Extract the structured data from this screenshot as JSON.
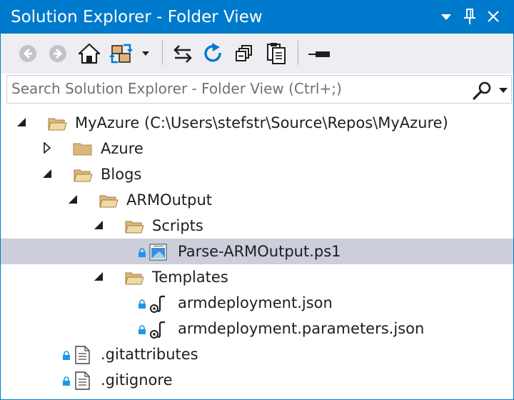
{
  "window": {
    "title": "Solution Explorer - Folder View",
    "accent_color": "#007acc",
    "title_text_color": "#ffffff"
  },
  "title_buttons": [
    "dropdown-arrow-icon",
    "pin-icon",
    "close-icon"
  ],
  "toolbar": {
    "buttons": [
      {
        "name": "back-button",
        "icon": "back-arrow-icon",
        "enabled": false
      },
      {
        "name": "forward-button",
        "icon": "forward-arrow-icon",
        "enabled": false
      },
      {
        "name": "home-button",
        "icon": "home-icon",
        "enabled": true
      },
      {
        "name": "switch-views-button",
        "icon": "switch-views-icon",
        "enabled": true
      },
      {
        "name": "sync-button",
        "icon": "sync-arrows-icon",
        "enabled": true
      },
      {
        "name": "refresh-button",
        "icon": "refresh-icon",
        "enabled": true
      },
      {
        "name": "collapse-all-button",
        "icon": "collapse-all-icon",
        "enabled": true
      },
      {
        "name": "show-all-files-button",
        "icon": "copy-pages-icon",
        "enabled": true
      },
      {
        "name": "properties-button",
        "icon": "properties-icon",
        "enabled": true
      }
    ]
  },
  "search": {
    "placeholder": "Search Solution Explorer - Folder View (Ctrl+;)",
    "value": ""
  },
  "tree": {
    "selection_color": "#cccedb",
    "items": [
      {
        "label": "MyAzure (C:\\Users\\stefstr\\Source\\Repos\\MyAzure)",
        "type": "folder-open",
        "depth": 0,
        "state": "expanded",
        "locked": false,
        "selected": false
      },
      {
        "label": "Azure",
        "type": "folder",
        "depth": 1,
        "state": "collapsed",
        "locked": false,
        "selected": false
      },
      {
        "label": "Blogs",
        "type": "folder-open",
        "depth": 1,
        "state": "expanded",
        "locked": false,
        "selected": false
      },
      {
        "label": "ARMOutput",
        "type": "folder-open",
        "depth": 2,
        "state": "expanded",
        "locked": false,
        "selected": false
      },
      {
        "label": "Scripts",
        "type": "folder-open",
        "depth": 3,
        "state": "expanded",
        "locked": false,
        "selected": false
      },
      {
        "label": "Parse-ARMOutput.ps1",
        "type": "powershell-file",
        "depth": 4,
        "state": "leaf",
        "locked": true,
        "selected": true
      },
      {
        "label": "Templates",
        "type": "folder-open",
        "depth": 3,
        "state": "expanded",
        "locked": false,
        "selected": false
      },
      {
        "label": "armdeployment.json",
        "type": "json-file",
        "depth": 4,
        "state": "leaf",
        "locked": true,
        "selected": false
      },
      {
        "label": "armdeployment.parameters.json",
        "type": "json-file",
        "depth": 4,
        "state": "leaf",
        "locked": true,
        "selected": false
      },
      {
        "label": ".gitattributes",
        "type": "text-file",
        "depth": 1,
        "state": "leaf",
        "locked": true,
        "selected": false
      },
      {
        "label": ".gitignore",
        "type": "text-file",
        "depth": 1,
        "state": "leaf",
        "locked": true,
        "selected": false
      }
    ]
  }
}
